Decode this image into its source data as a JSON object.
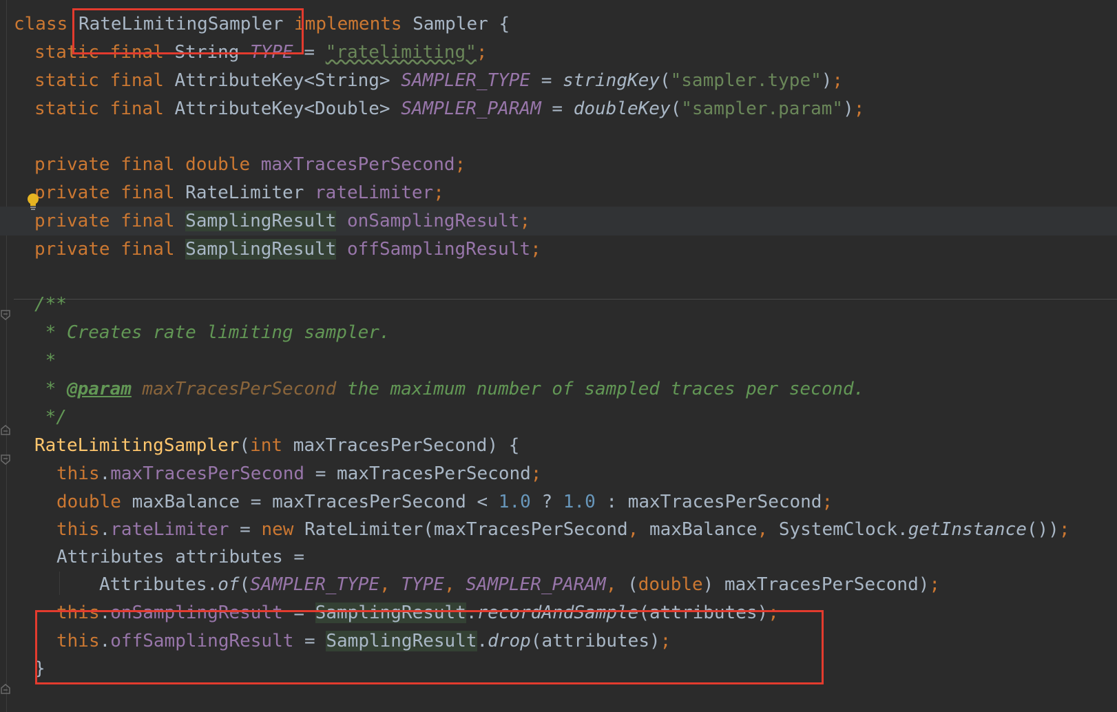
{
  "editor": {
    "lines": [
      "class RateLimitingSampler implements Sampler {",
      "static final String TYPE = \"ratelimiting\";",
      "static final AttributeKey<String> SAMPLER_TYPE = stringKey(\"sampler.type\");",
      "static final AttributeKey<Double> SAMPLER_PARAM = doubleKey(\"sampler.param\");",
      "private final double maxTracesPerSecond;",
      "private final RateLimiter rateLimiter;",
      "private final SamplingResult onSamplingResult;",
      "private final SamplingResult offSamplingResult;",
      "/**",
      " * Creates rate limiting sampler.",
      " *",
      " * @param maxTracesPerSecond the maximum number of sampled traces per second.",
      " */",
      "RateLimitingSampler(int maxTracesPerSecond) {",
      "this.maxTracesPerSecond = maxTracesPerSecond;",
      "double maxBalance = maxTracesPerSecond < 1.0 ? 1.0 : maxTracesPerSecond;",
      "this.rateLimiter = new RateLimiter(maxTracesPerSecond, maxBalance, SystemClock.getInstance());",
      "Attributes attributes =",
      "Attributes.of(SAMPLER_TYPE, TYPE, SAMPLER_PARAM, (double) maxTracesPerSecond);",
      "this.onSamplingResult = SamplingResult.recordAndSample(attributes);",
      "this.offSamplingResult = SamplingResult.drop(attributes);",
      "}"
    ]
  },
  "tokens": {
    "class_kw": "class",
    "class_name": "RateLimitingSampler",
    "implements_kw": "implements",
    "sampler_iface": "Sampler",
    "open_brace": "{",
    "static_kw": "static",
    "final_kw": "final",
    "string_type": "String",
    "type_const": "TYPE",
    "ratelimiting_str": "\"ratelimiting\"",
    "attrkey_string": "AttributeKey<String>",
    "attrkey_double": "AttributeKey<Double>",
    "sampler_type_const": "SAMPLER_TYPE",
    "sampler_param_const": "SAMPLER_PARAM",
    "string_key_fn": "stringKey",
    "double_key_fn": "doubleKey",
    "sampler_type_str": "\"sampler.type\"",
    "sampler_param_str": "\"sampler.param\"",
    "private_kw": "private",
    "double_kw": "double",
    "int_kw": "int",
    "max_traces_field": "maxTracesPerSecond",
    "rate_limiter_type": "RateLimiter",
    "rate_limiter_field": "rateLimiter",
    "sampling_result_type": "SamplingResult",
    "on_result_field": "onSamplingResult",
    "off_result_field": "offSamplingResult",
    "doc_open": "/**",
    "doc_line1": " * Creates rate limiting sampler.",
    "doc_star": " *",
    "doc_star_prefix": " * ",
    "doc_param_tag": "@param",
    "doc_param_name": "maxTracesPerSecond",
    "doc_param_desc": " the maximum number of sampled traces per second.",
    "doc_close": " */",
    "this_kw": "this",
    "new_kw": "new",
    "one_point_zero": "1.0",
    "max_balance": "maxBalance",
    "system_clock": "SystemClock",
    "get_instance": "getInstance",
    "attributes_type": "Attributes",
    "attributes_var": "attributes",
    "of_fn": "of",
    "record_and_sample_fn": "recordAndSample",
    "drop_fn": "drop",
    "close_brace": "}"
  },
  "colors": {
    "background": "#2b2b2b",
    "keyword": "#cc7832",
    "field": "#9876aa",
    "string": "#6a8759",
    "number": "#6897bb",
    "function_decl": "#ffc66d",
    "doc_comment": "#629755",
    "highlight_box": "#e33b2e"
  }
}
